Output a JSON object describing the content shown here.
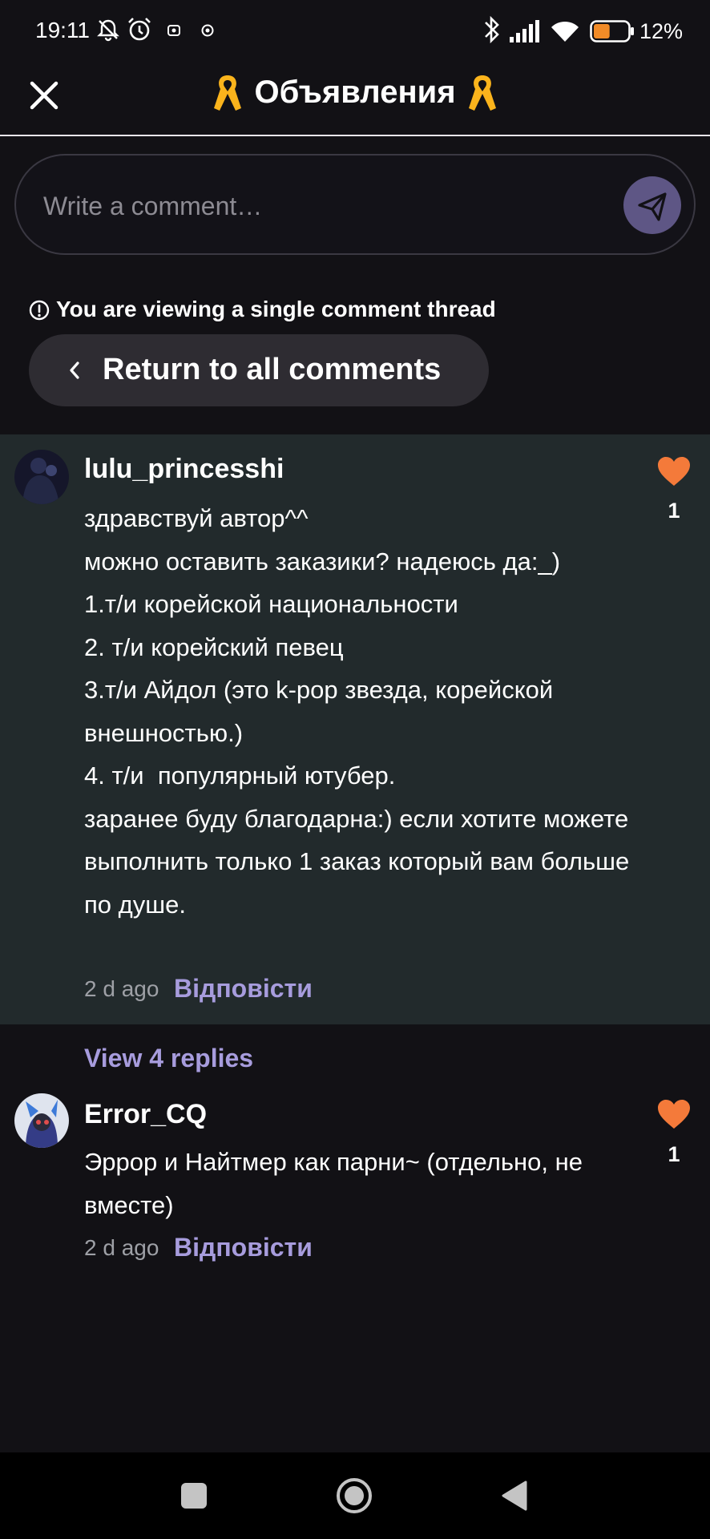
{
  "status_bar": {
    "time": "19:11",
    "battery": "12%",
    "battery_level": 0.12,
    "icons": [
      "mute-icon",
      "alarm-icon",
      "notification-icon",
      "vpn-icon",
      "bluetooth-icon",
      "signal-icon",
      "wifi-icon",
      "battery-icon"
    ]
  },
  "header": {
    "title": "Объявления",
    "close_icon": "close-icon",
    "decor_icon": "yellow-ribbon-icon"
  },
  "comment_box": {
    "placeholder": "Write a comment…",
    "send_icon": "send-icon"
  },
  "thread_notice": "You are viewing a single comment thread",
  "return_button": "Return to all comments",
  "comments": [
    {
      "username": "lulu_princesshi",
      "text": "здравствуй автор^^\nможно оставить заказики? надеюсь да:_)\n1.т/и корейской национальности\n2. т/и корейский певец\n3.т/и Айдол (это k-pop звезда, корейской внешностью.)\n4. т/и  популярный ютубер.\nзаранее буду благодарна:) если хотите можете выполнить только 1 заказ который вам больше по душе.",
      "time": "2 d ago",
      "reply_label": "Відповісти",
      "likes": "1"
    },
    {
      "username": "Error_CQ",
      "text": "Эррор и Найтмер как парни~ (отдельно, не вместе)",
      "time": "2 d ago",
      "reply_label": "Відповісти",
      "likes": "1"
    }
  ],
  "view_replies": "View 4 replies",
  "colors": {
    "background": "#121115",
    "highlight": "#222a2c",
    "accent": "#a79cdd",
    "like": "#f47a3a",
    "send_button": "#5e5685"
  }
}
